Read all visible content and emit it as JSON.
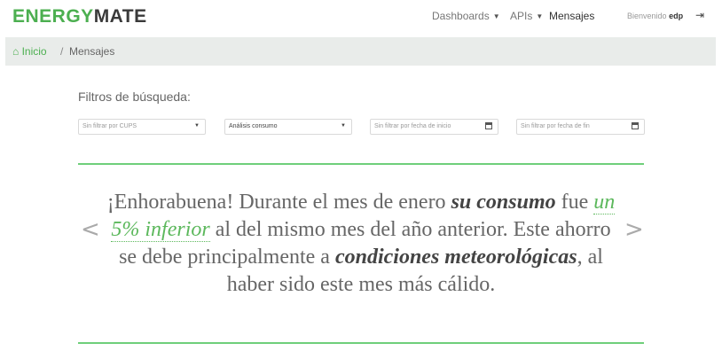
{
  "brand": {
    "part1": "ENERGY",
    "part2": "MATE"
  },
  "nav": {
    "dashboards": "Dashboards",
    "apis": "APIs",
    "mensajes": "Mensajes",
    "welcome": "Bienvenido",
    "user": "edp",
    "caret": "▼",
    "logout_icon": "⇥"
  },
  "breadcrumb": {
    "home_icon": "⌂",
    "home": "Inicio",
    "separator": "/",
    "current": "Mensajes"
  },
  "filters": {
    "title": "Filtros de búsqueda:",
    "cups": "Sin filtrar por CUPS",
    "analysis": "Análisis consumo",
    "start_date": "Sin filtrar por fecha de inicio",
    "end_date": "Sin filtrar por fecha de fin"
  },
  "message": {
    "part1": "¡Enhorabuena! Durante el mes de enero ",
    "bold1": "su consumo",
    "part2": " fue ",
    "highlight": "un 5% inferior",
    "part3": " al del mismo mes del año anterior. Este ahorro se debe principalmente a ",
    "bold2": "condiciones meteorológicas",
    "part4": ", al haber sido este mes más cálido."
  },
  "carousel": {
    "prev": "<",
    "next": ">"
  },
  "colors": {
    "brand_green": "#4caf50",
    "accent": "#6fcf7a",
    "breadcrumb_bg": "#e9ecea"
  }
}
